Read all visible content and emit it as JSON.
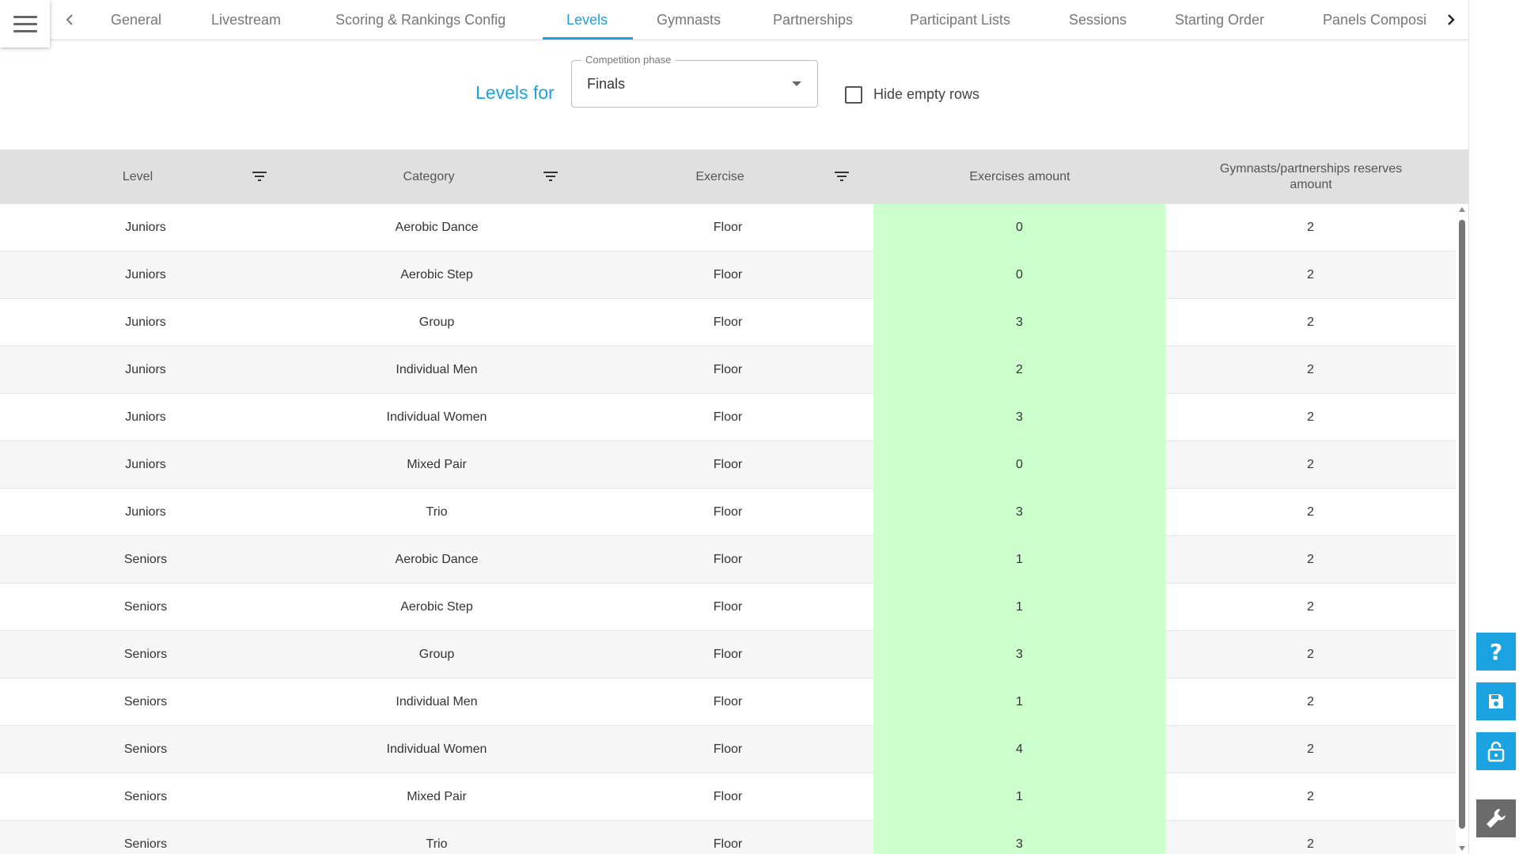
{
  "nav": {
    "tabs": [
      {
        "label": "General",
        "active": false
      },
      {
        "label": "Livestream",
        "active": false
      },
      {
        "label": "Scoring & Rankings Config",
        "active": false
      },
      {
        "label": "Levels",
        "active": true
      },
      {
        "label": "Gymnasts",
        "active": false
      },
      {
        "label": "Partnerships",
        "active": false
      },
      {
        "label": "Participant Lists",
        "active": false
      },
      {
        "label": "Sessions",
        "active": false
      },
      {
        "label": "Starting Order",
        "active": false
      },
      {
        "label": "Panels Composi",
        "active": false
      }
    ],
    "prev_icon": "chevron-left-icon",
    "next_icon": "chevron-right-icon",
    "accent_color": "#1aa3e0"
  },
  "header": {
    "levels_for_label": "Levels for",
    "phase_select": {
      "label": "Competition phase",
      "value": "Finals"
    },
    "hide_empty_rows": {
      "label": "Hide empty rows",
      "checked": false
    }
  },
  "table": {
    "columns": [
      "Level",
      "Category",
      "Exercise",
      "Exercises amount",
      "Gymnasts/partnerships reserves amount"
    ],
    "highlight_color": "#ccffcc",
    "rows": [
      [
        "Juniors",
        "Aerobic Dance",
        "Floor",
        "0",
        "2"
      ],
      [
        "Juniors",
        "Aerobic Step",
        "Floor",
        "0",
        "2"
      ],
      [
        "Juniors",
        "Group",
        "Floor",
        "3",
        "2"
      ],
      [
        "Juniors",
        "Individual Men",
        "Floor",
        "2",
        "2"
      ],
      [
        "Juniors",
        "Individual Women",
        "Floor",
        "3",
        "2"
      ],
      [
        "Juniors",
        "Mixed Pair",
        "Floor",
        "0",
        "2"
      ],
      [
        "Juniors",
        "Trio",
        "Floor",
        "3",
        "2"
      ],
      [
        "Seniors",
        "Aerobic Dance",
        "Floor",
        "1",
        "2"
      ],
      [
        "Seniors",
        "Aerobic Step",
        "Floor",
        "1",
        "2"
      ],
      [
        "Seniors",
        "Group",
        "Floor",
        "3",
        "2"
      ],
      [
        "Seniors",
        "Individual Men",
        "Floor",
        "1",
        "2"
      ],
      [
        "Seniors",
        "Individual Women",
        "Floor",
        "4",
        "2"
      ],
      [
        "Seniors",
        "Mixed Pair",
        "Floor",
        "1",
        "2"
      ],
      [
        "Seniors",
        "Trio",
        "Floor",
        "3",
        "2"
      ]
    ]
  },
  "side_actions": [
    {
      "icon": "help-icon"
    },
    {
      "icon": "save-icon"
    },
    {
      "icon": "unlock-icon"
    },
    {
      "icon": "wrench-icon"
    }
  ]
}
